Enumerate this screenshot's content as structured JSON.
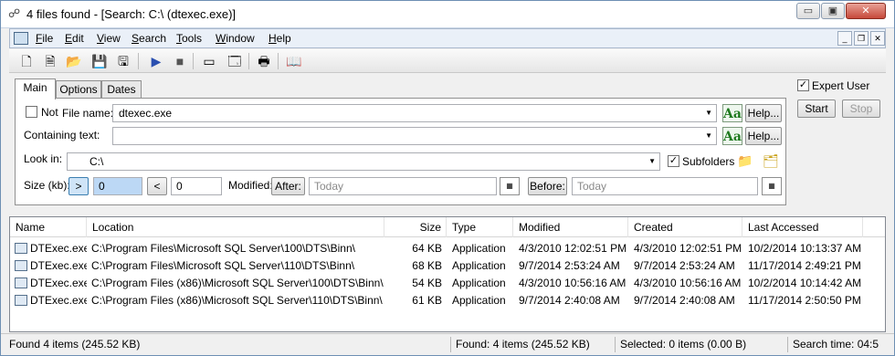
{
  "window": {
    "title": "4 files found - [Search: C:\\ (dtexec.exe)]",
    "caption_minimize": "▭",
    "caption_maximize": "▣",
    "caption_close": "✕"
  },
  "menu": {
    "items": [
      "File",
      "Edit",
      "View",
      "Search",
      "Tools",
      "Window",
      "Help"
    ],
    "mdi_min": "_",
    "mdi_restore": "❐",
    "mdi_close": "✕"
  },
  "toolbar": {
    "icons": [
      "new-search-icon",
      "new-window-icon",
      "open-icon",
      "save-icon",
      "save-as-icon",
      "start-icon",
      "stop-icon",
      "window-icon",
      "properties-icon",
      "print-icon",
      "help-book-icon"
    ],
    "glyphs": [
      "🗋",
      "🗎",
      "📂",
      "💾",
      "🖫",
      "▶",
      "■",
      "▭",
      "🗔",
      "🖶",
      "📖"
    ]
  },
  "tabs": [
    "Main",
    "Options",
    "Dates"
  ],
  "main": {
    "not_label": "Not",
    "file_name_label": "File name:",
    "file_name_value": "dtexec.exe",
    "containing_text_label": "Containing text:",
    "containing_text_value": "",
    "help_label": "Help...",
    "aa_label": "Aa",
    "look_in_label": "Look in:",
    "look_in_value": "C:\\",
    "subfolders_label": "Subfolders",
    "size_label": "Size (kb):",
    "size_gt_label": ">",
    "size_gt_value": "0",
    "size_lt_label": "<",
    "size_lt_value": "0",
    "modified_label": "Modified:",
    "after_label": "After:",
    "after_value": "Today",
    "before_label": "Before:",
    "before_value": "Today",
    "calendar_glyph": "▦",
    "check_glyph": "✓",
    "combo_arrow": "▼"
  },
  "side": {
    "expert_user_label": "Expert User",
    "start_label": "Start",
    "stop_label": "Stop"
  },
  "results": {
    "columns": [
      "Name",
      "Location",
      "Size",
      "Type",
      "Modified",
      "Created",
      "Last Accessed"
    ],
    "rows": [
      {
        "name": "DTExec.exe",
        "location": "C:\\Program Files\\Microsoft SQL Server\\100\\DTS\\Binn\\",
        "size": "64 KB",
        "type": "Application",
        "modified": "4/3/2010 12:02:51 PM",
        "created": "4/3/2010 12:02:51 PM",
        "accessed": "10/2/2014 10:13:37 AM"
      },
      {
        "name": "DTExec.exe",
        "location": "C:\\Program Files\\Microsoft SQL Server\\110\\DTS\\Binn\\",
        "size": "68 KB",
        "type": "Application",
        "modified": "9/7/2014 2:53:24 AM",
        "created": "9/7/2014 2:53:24 AM",
        "accessed": "11/17/2014 2:49:21 PM"
      },
      {
        "name": "DTExec.exe",
        "location": "C:\\Program Files (x86)\\Microsoft SQL Server\\100\\DTS\\Binn\\",
        "size": "54 KB",
        "type": "Application",
        "modified": "4/3/2010 10:56:16 AM",
        "created": "4/3/2010 10:56:16 AM",
        "accessed": "10/2/2014 10:14:42 AM"
      },
      {
        "name": "DTExec.exe",
        "location": "C:\\Program Files (x86)\\Microsoft SQL Server\\110\\DTS\\Binn\\",
        "size": "61 KB",
        "type": "Application",
        "modified": "9/7/2014 2:40:08 AM",
        "created": "9/7/2014 2:40:08 AM",
        "accessed": "11/17/2014 2:50:50 PM"
      }
    ]
  },
  "status": {
    "left": "Found 4 items (245.52 KB)",
    "middle": "Found: 4 items (245.52 KB)",
    "selected": "Selected: 0 items (0.00 B)",
    "time": "Search time: 04:5"
  }
}
